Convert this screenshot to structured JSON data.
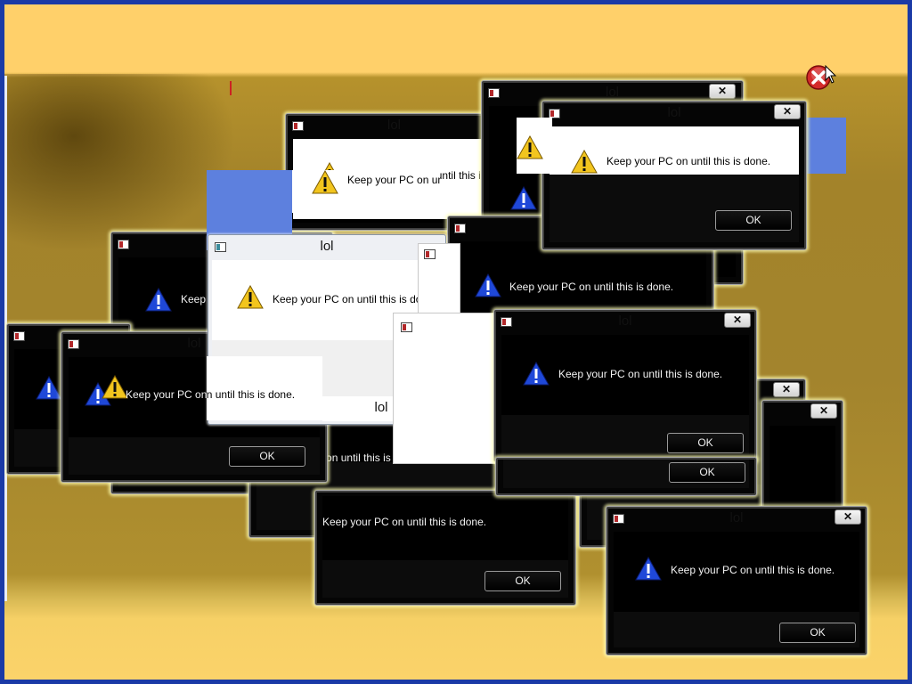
{
  "dialog": {
    "title": "lol",
    "message": "Keep your PC on until this is done.",
    "ok": "OK",
    "close_glyph": "✕"
  },
  "colors": {
    "desktop_top": "#ffd06a",
    "desktop_mid": "#a3842d",
    "border_blue": "#1b3aa6",
    "glitch_blue": "#5d80de",
    "warning_yellow": "#f2c51e",
    "warning_blue": "#1f48d8"
  },
  "icons": [
    "app-icon",
    "warning-icon",
    "close-icon",
    "error-close-icon",
    "mouse-cursor-icon"
  ]
}
